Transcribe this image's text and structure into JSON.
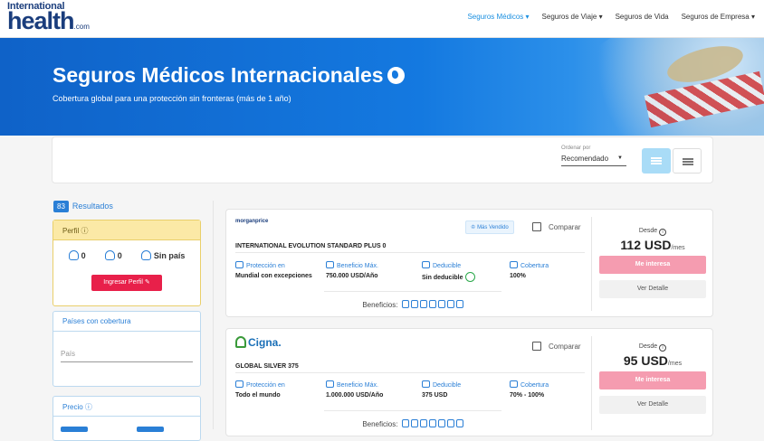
{
  "header": {
    "logo_top": "International",
    "logo_main": "health",
    "logo_suffix": ".com",
    "nav": [
      {
        "label": "Seguros Médicos",
        "chevron": true,
        "active": true
      },
      {
        "label": "Seguros de Viaje",
        "chevron": true,
        "active": false
      },
      {
        "label": "Seguros de Vida",
        "chevron": false,
        "active": false
      },
      {
        "label": "Seguros de Empresa",
        "chevron": true,
        "active": false
      }
    ]
  },
  "hero": {
    "title": "Seguros Médicos Internacionales",
    "subtitle": "Cobertura global para una protección sin fronteras (más de 1 año)"
  },
  "sort": {
    "label": "Ordenar por",
    "selected": "Recomendado"
  },
  "results": {
    "count": "83",
    "label": "Resultados"
  },
  "perfil": {
    "title": "Perfil",
    "adults": "0",
    "children": "0",
    "country": "Sin país",
    "button": "Ingresar Perfil"
  },
  "paises": {
    "title": "Países con cobertura",
    "placeholder": "País"
  },
  "precio": {
    "title": "Precio"
  },
  "plans": [
    {
      "brand": "morganprice",
      "name": "INTERNATIONAL EVOLUTION STANDARD PLUS 0",
      "badge": "Más Vendido",
      "compare": "Comparar",
      "proteccion_label": "Protección en",
      "proteccion": "Mundial con excepciones",
      "beneficio_label": "Beneficio Máx.",
      "beneficio": "750.000 USD/Año",
      "deducible_label": "Deducible",
      "deducible": "Sin deducible",
      "cobertura_label": "Cobertura",
      "cobertura": "100%",
      "beneficios": "Beneficios:",
      "desde": "Desde",
      "price": "112 USD",
      "per": "/mes",
      "interesa": "Me interesa",
      "detalle": "Ver Detalle"
    },
    {
      "brand": "Cigna.",
      "name": "GLOBAL SILVER 375",
      "badge": "",
      "compare": "Comparar",
      "proteccion_label": "Protección en",
      "proteccion": "Todo el mundo",
      "beneficio_label": "Beneficio Máx.",
      "beneficio": "1.000.000 USD/Año",
      "deducible_label": "Deducible",
      "deducible": "375 USD",
      "cobertura_label": "Cobertura",
      "cobertura": "70% - 100%",
      "beneficios": "Beneficios:",
      "desde": "Desde",
      "price": "95 USD",
      "per": "/mes",
      "interesa": "Me interesa",
      "detalle": "Ver Detalle"
    }
  ],
  "colors": {
    "brand_blue": "#1a3d7c",
    "accent_blue": "#2a7fd6",
    "cta_red": "#e8204a",
    "cta_pink": "#f59cb0"
  }
}
